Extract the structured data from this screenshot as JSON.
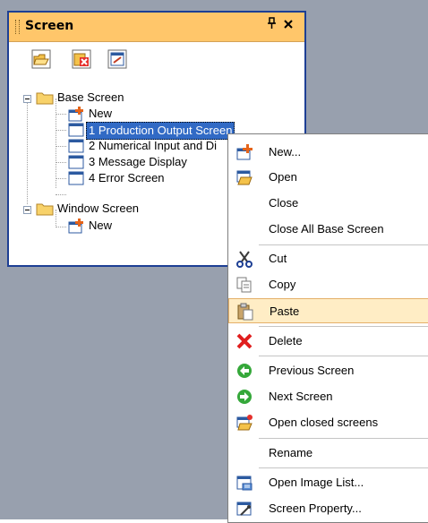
{
  "panel": {
    "title": "Screen",
    "pin_glyph": "—",
    "close_glyph": "✕"
  },
  "toolbar": {
    "buttons": [
      {
        "icon": "open-folder-icon"
      },
      {
        "icon": "delete-screen-icon"
      },
      {
        "icon": "screen-property-icon"
      }
    ]
  },
  "tree": {
    "base_screen": "Base Screen",
    "base_new": "New",
    "screens": [
      "1 Production Output Screen",
      "2 Numerical Input and Di",
      "3 Message Display",
      "4 Error Screen"
    ],
    "window_screen": "Window Screen",
    "window_new": "New"
  },
  "context_menu": {
    "items": [
      {
        "label": "New...",
        "icon": "new-screen-icon"
      },
      {
        "label": "Open",
        "icon": "open-folder-icon"
      },
      {
        "label": "Close",
        "icon": ""
      },
      {
        "label": "Close All Base Screen",
        "icon": ""
      },
      {
        "label": "Cut",
        "icon": "scissors-icon"
      },
      {
        "label": "Copy",
        "icon": "copy-icon"
      },
      {
        "label": "Paste",
        "icon": "paste-icon"
      },
      {
        "label": "Delete",
        "icon": "delete-icon"
      },
      {
        "label": "Previous Screen",
        "icon": "previous-arrow-icon"
      },
      {
        "label": "Next Screen",
        "icon": "next-arrow-icon"
      },
      {
        "label": "Open closed screens",
        "icon": "open-closed-screens-icon"
      },
      {
        "label": "Rename",
        "icon": ""
      },
      {
        "label": "Open Image List...",
        "icon": "image-list-icon"
      },
      {
        "label": "Screen Property...",
        "icon": "screen-property-icon"
      }
    ],
    "highlighted": "Paste"
  },
  "colors": {
    "header": "#ffc66a",
    "panel_border": "#1d3f94",
    "selection": "#316ac5",
    "menu_highlight": "#ffedc5",
    "workspace": "#98a0ae"
  }
}
